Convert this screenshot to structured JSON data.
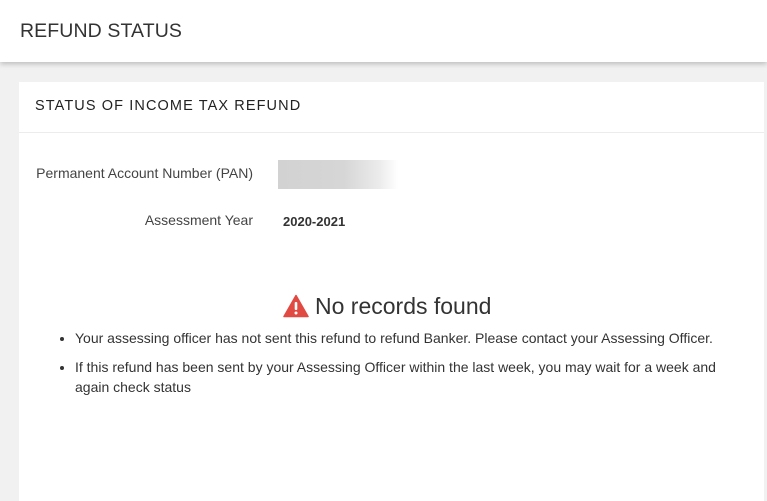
{
  "header": {
    "title": "REFUND STATUS"
  },
  "card": {
    "title": "STATUS OF INCOME TAX REFUND",
    "fields": {
      "pan_label": "Permanent Account Number (PAN)",
      "ay_label": "Assessment Year",
      "ay_value": "2020-2021"
    },
    "result": {
      "icon": "warning-triangle-icon",
      "icon_color": "#e14a43",
      "heading": "No records found",
      "messages": [
        "Your assessing officer has not sent this refund to refund Banker. Please contact your Assessing Officer.",
        "If this refund has been sent by your Assessing Officer within the last week, you may wait for a week and again check status"
      ]
    }
  }
}
